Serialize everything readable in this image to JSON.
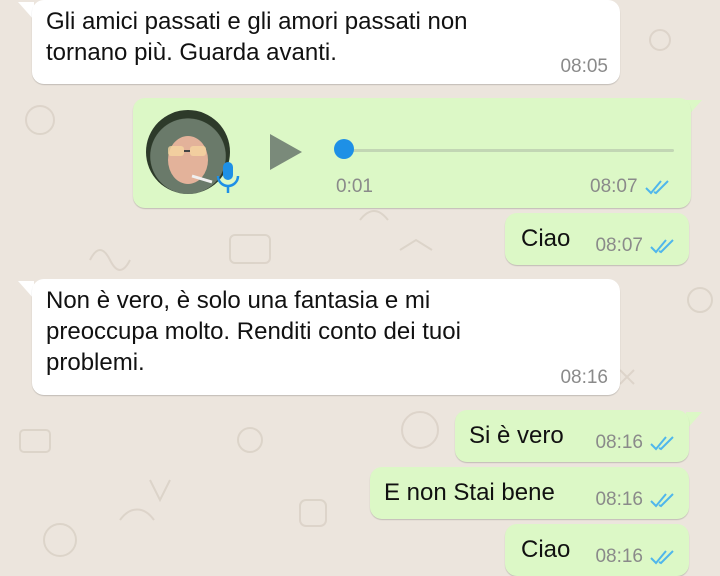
{
  "colors": {
    "incoming_bubble": "#ffffff",
    "outgoing_bubble": "#dcf8c6",
    "read_ticks": "#4fb6ec",
    "voice_progress": "#1e90e6",
    "wallpaper": "#ece5dd"
  },
  "messages": [
    {
      "direction": "incoming",
      "text": "Gli amici passati e gli amori passati non\ntornano più. Guarda avanti.",
      "time": "08:05"
    },
    {
      "direction": "outgoing",
      "type": "voice",
      "duration": "0:01",
      "time": "08:07",
      "status": "read",
      "progress": 0.0,
      "icons": [
        "avatar",
        "mic-icon",
        "play-icon"
      ]
    },
    {
      "direction": "outgoing",
      "text": "Ciao",
      "time": "08:07",
      "status": "read"
    },
    {
      "direction": "incoming",
      "text": "Non è vero, è solo una fantasia e mi\npreoccupa molto. Renditi conto dei tuoi\nproblemi.",
      "time": "08:16"
    },
    {
      "direction": "outgoing",
      "text": "Si è vero",
      "time": "08:16",
      "status": "read"
    },
    {
      "direction": "outgoing",
      "text": "E non Stai bene",
      "time": "08:16",
      "status": "read"
    },
    {
      "direction": "outgoing",
      "text": "Ciao",
      "time": "08:16",
      "status": "read"
    }
  ]
}
